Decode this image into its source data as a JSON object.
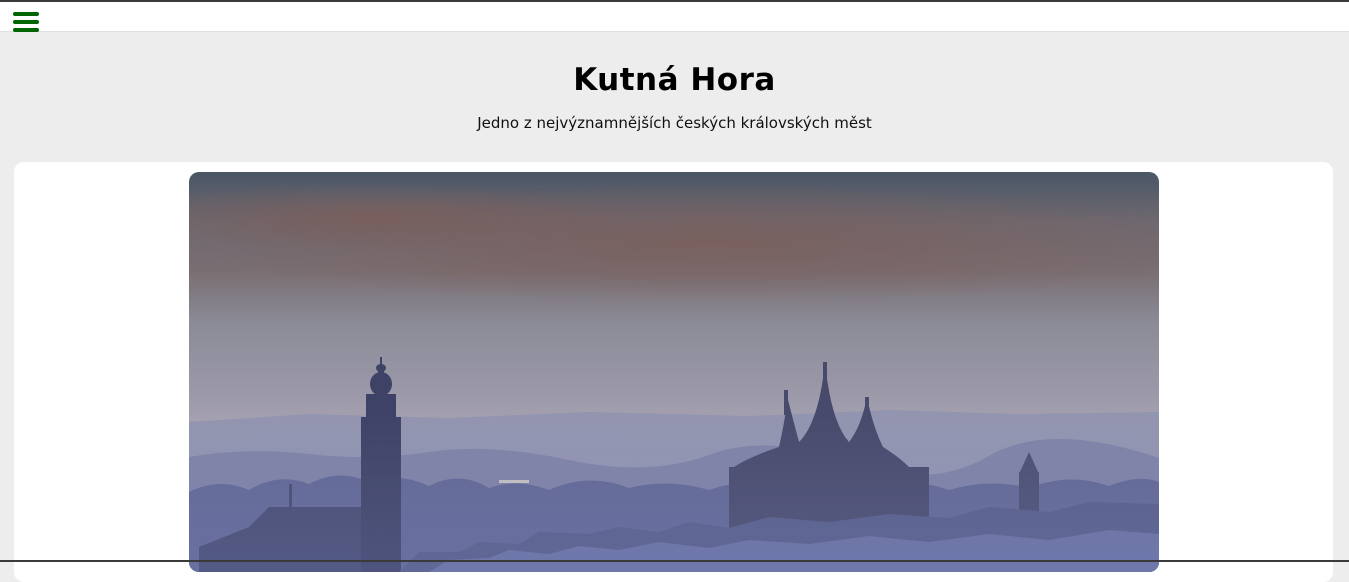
{
  "header": {
    "title": "Kutná Hora",
    "subtitle": "Jedno z nejvýznamnějších českých královských měst"
  },
  "menu": {
    "icon": "hamburger-menu-icon"
  },
  "colors": {
    "menu_icon": "#006400",
    "page_background": "#ededed",
    "card_background": "#ffffff"
  },
  "hero_image": {
    "subject": "city-skyline-photo"
  }
}
